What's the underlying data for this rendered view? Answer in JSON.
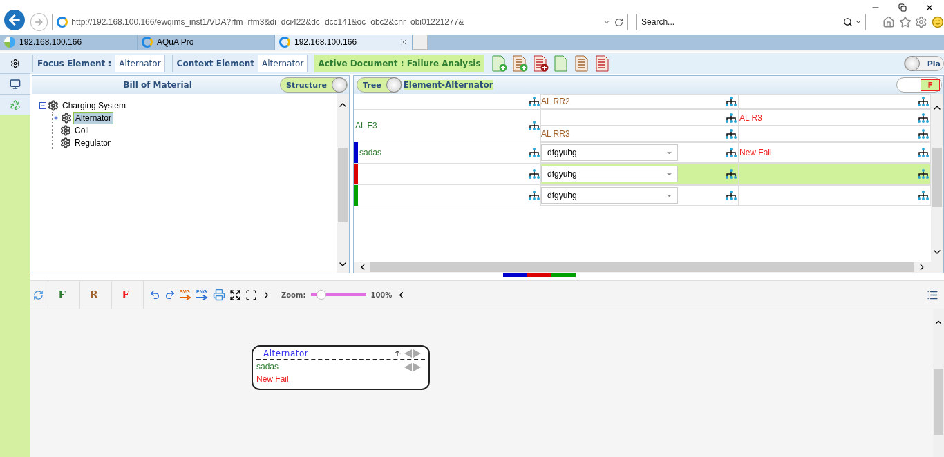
{
  "browser": {
    "url": "http://192.168.100.166/ewqims_inst1/VDA?rfm=rfm3&di=dci422&dc=dcc141&oc=obc2&cnr=obi01221277&",
    "search": {
      "placeholder": "Search..."
    },
    "tabs": [
      {
        "label": "192.168.100.166",
        "kind": "site",
        "selected": false
      },
      {
        "label": "AQuA Pro",
        "kind": "ie",
        "selected": false
      },
      {
        "label": "192.168.100.166",
        "kind": "ie",
        "selected": true
      }
    ]
  },
  "header_bar": {
    "focus": {
      "label": "Focus Element :",
      "value": "Alternator"
    },
    "context": {
      "label": "Context Element",
      "value": "Alternator"
    },
    "document": "Active Document : Failure Analysis",
    "toggle": {
      "label": "Pla",
      "on": false
    }
  },
  "bom": {
    "title": "Bill of Material",
    "toggle": {
      "label": "Structure",
      "on": true
    },
    "tree": [
      {
        "label": "Charging System",
        "expanded": true,
        "selected": false,
        "children": [
          {
            "label": "Alternator",
            "expanded": false,
            "selected": true
          },
          {
            "label": "Coil",
            "selected": false
          },
          {
            "label": "Regulator",
            "selected": false
          }
        ]
      }
    ]
  },
  "analysis": {
    "toggle": {
      "label": "Tree",
      "on": true
    },
    "title": "Element-Alternator",
    "filter": {
      "label": "F",
      "on": true
    },
    "rows": [
      {
        "subrows": [
          {
            "column_2": {
              "kind": "text",
              "text": "AL RR2"
            },
            "selected": false
          }
        ]
      },
      {
        "column_1": "AL F3",
        "subrows": [
          {
            "column_2": {
              "kind": "text"
            },
            "column_3": "AL R3",
            "selected": false
          },
          {
            "column_2": {
              "kind": "text",
              "text": "AL RR3"
            },
            "selected": false
          }
        ]
      },
      {
        "column_1": "sadas",
        "color": "#0000cc",
        "subrows": [
          {
            "column_2": {
              "kind": "dropdown",
              "text": "dfgyuhg"
            },
            "column_3": "New Fail",
            "selected": false
          }
        ]
      },
      {
        "color": "#dd0000",
        "subrows": [
          {
            "column_2": {
              "kind": "dropdown",
              "text": "dfgyuhg"
            },
            "selected": true
          }
        ]
      },
      {
        "color": "#00a000",
        "subrows": [
          {
            "column_2": {
              "kind": "dropdown",
              "text": "dfgyuhg"
            },
            "selected": false
          }
        ]
      }
    ]
  },
  "toolbar": {
    "buttons": [
      {
        "label": "F",
        "color": "#2e7d32"
      },
      {
        "label": "R",
        "color": "#a0612b"
      },
      {
        "label": "F",
        "color": "#ee2222"
      }
    ],
    "exports": [
      "SVG",
      "PNG"
    ],
    "zoom_label": "Zoom:",
    "zoom": {
      "level": 0.18
    },
    "zoom_value": "100%"
  },
  "diagram": {
    "node": {
      "title": "Alternator",
      "items": [
        {
          "label": "sadas",
          "color": "#2e7d32"
        },
        {
          "label": "New Fail",
          "color": "#ee2222"
        }
      ]
    }
  }
}
